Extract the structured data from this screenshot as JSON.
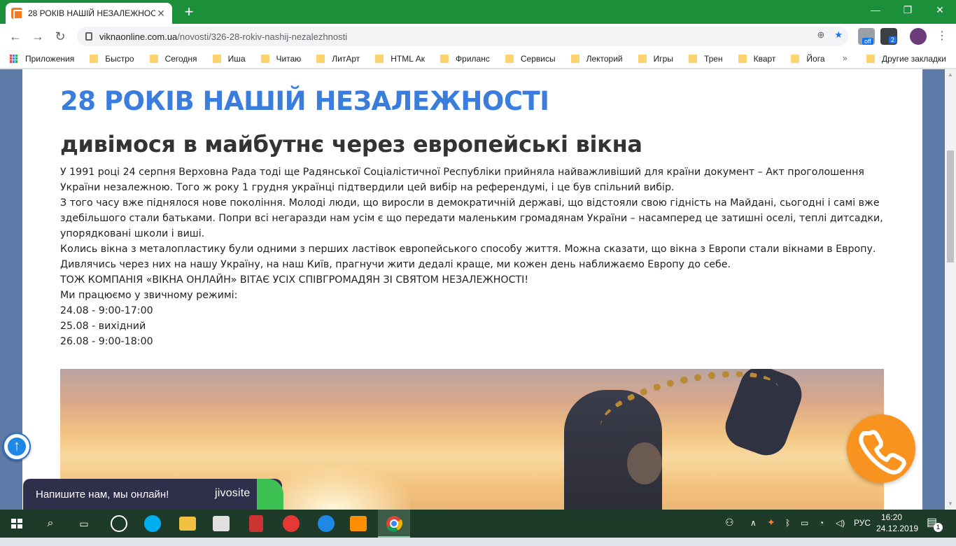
{
  "browser": {
    "tab_title": "28 РОКІВ НАШІЙ НЕЗАЛЕЖНОС",
    "url_host": "viknaonline.com.ua",
    "url_path": "/novosti/326-28-rokiv-nashij-nezalezhnosti",
    "extension_badge_off": "off",
    "extension_badge_count": "2",
    "bookmarks": [
      "Приложения",
      "Быстро",
      "Сегодня",
      "Иша",
      "Читаю",
      "ЛитАрт",
      "HTML Ак",
      "Фриланс",
      "Сервисы",
      "Лекторий",
      "Игры",
      "Трен",
      "Кварт",
      "Йога"
    ],
    "bookmarks_more": "»",
    "other_bookmarks": "Другие закладки"
  },
  "article": {
    "title": "28 РОКІВ НАШІЙ НЕЗАЛЕЖНОСТІ",
    "subtitle": "дивімося в майбутнє через европейські вікна",
    "paragraphs": [
      "У 1991 році 24 серпня Верховна Рада тоді ще Радянської Соціалістичної Республіки прийняла найважливіший для країни документ – Акт проголошення України незалежною. Того ж року 1 грудня українці підтвердили цей вибір на референдумі, і це був спільний вибір.",
      "З того часу вже піднялося нове покоління. Молоді люди, що виросли в демократичній державі, що відстояли свою гідність на Майдані, сьогодні і самі вже здебільшого стали батьками. Попри всі негаразди нам усім є що передати маленьким громадянам України – насамперед це затишні оселі, теплі дитсадки, упорядковані школи і виші.",
      "Колись вікна з металопластику були одними з перших ластівок европейського способу життя. Можна сказати, що вікна з Европи стали вікнами в Европу. Дивлячись через них на нашу Україну, на наш Київ, прагнучи жити дедалі краще, ми кожен день наближаємо Европу до себе.",
      "ТОЖ КОМПАНІЯ «ВІКНА ОНЛАЙН» ВІТАЄ УСІХ СПІВГРОМАДЯН ЗІ СВЯТОМ НЕЗАЛЕЖНОСТІ!",
      "Ми працюємо у звичному режимі:",
      "24.08 - 9:00-17:00",
      "25.08 - вихідний",
      "26.08 - 9:00-18:00"
    ]
  },
  "widgets": {
    "chat_label": "Напишите нам, мы онлайн!",
    "chat_brand": "jivosite",
    "scroll_up_icon": "arrow-up-icon",
    "call_icon": "phone-icon"
  },
  "taskbar": {
    "language": "РУС",
    "time": "16:20",
    "date": "24.12.2019",
    "notification_count": "1"
  },
  "colors": {
    "chrome_frame": "#1b8f3a",
    "title_blue": "#3a7ddc",
    "call_orange": "#f7931e",
    "chat_bg": "#2f2e4b",
    "taskbar": "#1e3b2a"
  }
}
